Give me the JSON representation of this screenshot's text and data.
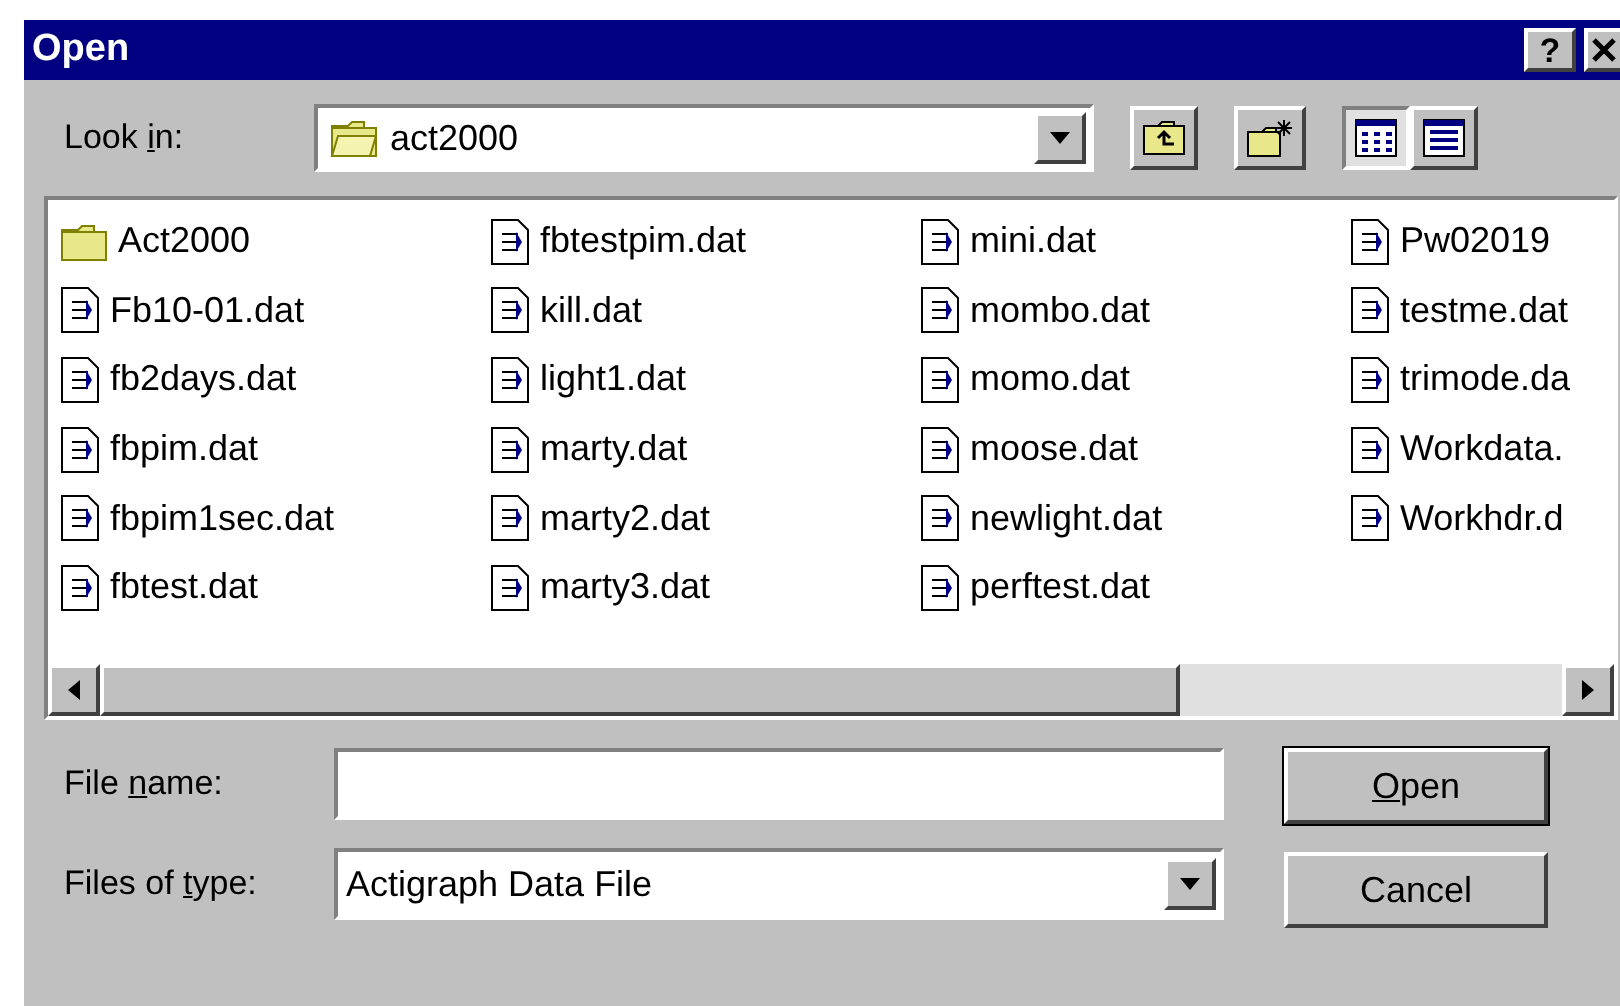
{
  "window": {
    "title": "Open",
    "help_button": "?"
  },
  "look_in": {
    "label": {
      "before": "Look ",
      "key": "i",
      "after": "n:"
    },
    "value": "act2000"
  },
  "view_buttons": [
    {
      "kind": "list",
      "selected": true
    },
    {
      "kind": "details",
      "selected": false
    }
  ],
  "files": [
    {
      "name": "Act2000",
      "kind": "folder"
    },
    {
      "name": "Fb10-01.dat",
      "kind": "file"
    },
    {
      "name": "fb2days.dat",
      "kind": "file"
    },
    {
      "name": "fbpim.dat",
      "kind": "file"
    },
    {
      "name": "fbpim1sec.dat",
      "kind": "file"
    },
    {
      "name": "fbtest.dat",
      "kind": "file"
    },
    {
      "name": "fbtestpim.dat",
      "kind": "file"
    },
    {
      "name": "kill.dat",
      "kind": "file"
    },
    {
      "name": "light1.dat",
      "kind": "file"
    },
    {
      "name": "marty.dat",
      "kind": "file"
    },
    {
      "name": "marty2.dat",
      "kind": "file"
    },
    {
      "name": "marty3.dat",
      "kind": "file"
    },
    {
      "name": "mini.dat",
      "kind": "file"
    },
    {
      "name": "mombo.dat",
      "kind": "file"
    },
    {
      "name": "momo.dat",
      "kind": "file"
    },
    {
      "name": "moose.dat",
      "kind": "file"
    },
    {
      "name": "newlight.dat",
      "kind": "file"
    },
    {
      "name": "perftest.dat",
      "kind": "file"
    },
    {
      "name": "Pw02019",
      "kind": "file"
    },
    {
      "name": "testme.dat",
      "kind": "file"
    },
    {
      "name": "trimode.da",
      "kind": "file"
    },
    {
      "name": "Workdata.",
      "kind": "file"
    },
    {
      "name": "Workhdr.d",
      "kind": "file"
    }
  ],
  "file_name": {
    "label": {
      "before": "File ",
      "key": "n",
      "after": "ame:"
    }
  },
  "files_of_type": {
    "label": {
      "before": "Files of ",
      "key": "t",
      "after": "ype:"
    },
    "value": "Actigraph Data File"
  },
  "buttons": [
    {
      "label": {
        "key": "O",
        "after": "pen"
      },
      "default": true
    },
    {
      "label": {
        "before": "Cancel"
      },
      "default": false
    }
  ]
}
